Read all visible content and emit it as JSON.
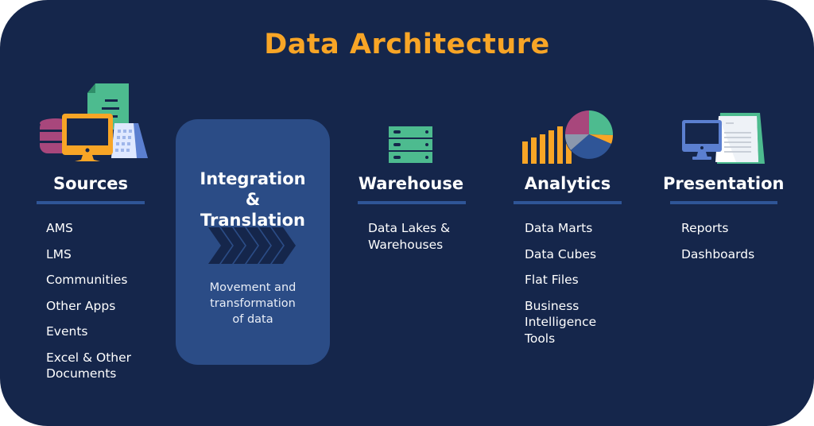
{
  "title": "Data Architecture",
  "colors": {
    "background": "#15264b",
    "accent": "#f8a526",
    "divider": "#2f5597",
    "integration_box": "#2b4c86",
    "green": "#4dbb8f",
    "magenta": "#a8477c",
    "blue": "#5b7fd0"
  },
  "columns": [
    {
      "id": "sources",
      "title": "Sources",
      "icon": "sources-icon",
      "items": [
        "AMS",
        "LMS",
        "Communities",
        "Other Apps",
        "Events",
        "Excel & Other Documents"
      ]
    },
    {
      "id": "integration",
      "title": "Integration & Translation",
      "icon": "chevrons-right-icon",
      "description": "Movement and transformation of data"
    },
    {
      "id": "warehouse",
      "title": "Warehouse",
      "icon": "server-icon",
      "items": [
        "Data Lakes & Warehouses"
      ]
    },
    {
      "id": "analytics",
      "title": "Analytics",
      "icon": "chart-icon",
      "items": [
        "Data Marts",
        "Data Cubes",
        "Flat Files",
        "Business Intelligence Tools"
      ]
    },
    {
      "id": "presentation",
      "title": "Presentation",
      "icon": "presentation-icon",
      "items": [
        "Reports",
        "Dashboards"
      ]
    }
  ]
}
